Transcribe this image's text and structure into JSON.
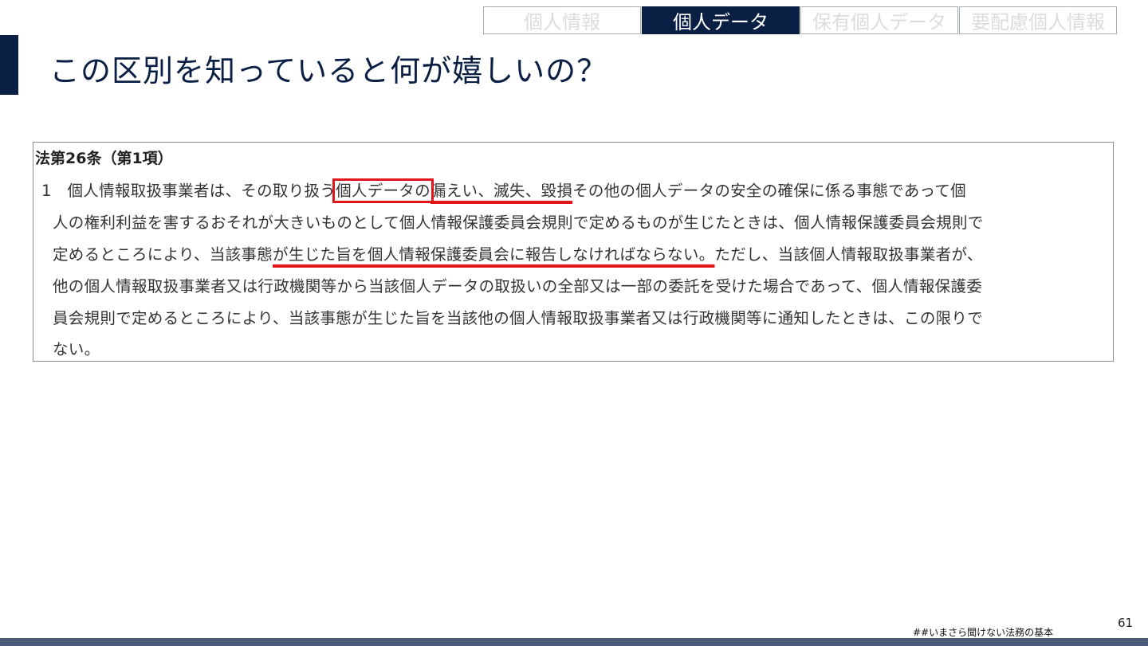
{
  "tabs": [
    {
      "label": "個人情報",
      "active": false
    },
    {
      "label": "個人データ",
      "active": true
    },
    {
      "label": "保有個人データ",
      "active": false
    },
    {
      "label": "要配慮個人情報",
      "active": false
    }
  ],
  "title": "この区別を知っていると何が嬉しいの？",
  "law": {
    "heading": "法第26条（第1項）",
    "line1_a": "1　個人情報取扱事業者は、その取り扱う",
    "line1_box": "個人データの",
    "line1_ul": "漏えい、滅失、毀損",
    "line1_b": "その他の個人データの安全の確保に係る事態であって個",
    "line2": "人の権利利益を害するおそれが大きいものとして個人情報保護委員会規則で定めるものが生じたときは、個人情報保護委員会規則で",
    "line3_a": "定めるところにより、当該事態",
    "line3_ul": "が生じた旨を個人情報保護委員会に報告しなければならない。",
    "line3_b": "ただし、当該個人情報取扱事業者が、",
    "line4": "他の個人情報取扱事業者又は行政機関等から当該個人データの取扱いの全部又は一部の委託を受けた場合であって、個人情報保護委",
    "line5": "員会規則で定めるところにより、当該事態が生じた旨を当該他の個人情報取扱事業者又は行政機関等に通知したときは、この限りで",
    "line6": "ない。"
  },
  "footer": {
    "tag": "##いまさら聞けない法務の基本",
    "page_number": "61"
  },
  "colors": {
    "navy": "#0a1f44",
    "highlight_red": "#e0161b",
    "bottom_bar": "#4a5a78"
  }
}
